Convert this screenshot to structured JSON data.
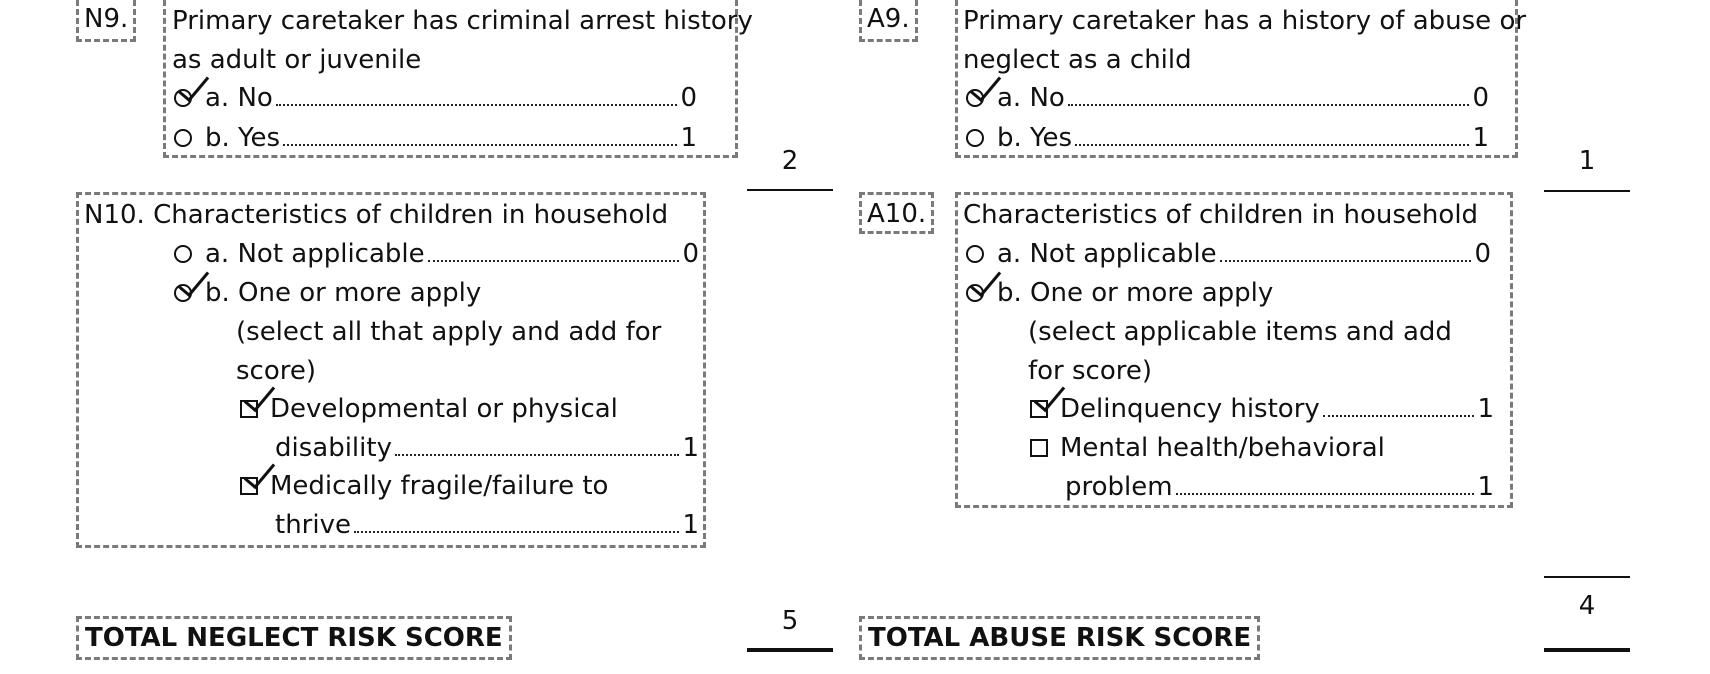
{
  "neglect": {
    "n9": {
      "tag": "N9.",
      "question_line1": "Primary caretaker has criminal arrest history",
      "question_line2": "as adult or juvenile",
      "option_a": "a. No",
      "option_a_value": "0",
      "option_b": "b. Yes",
      "option_b_value": "1",
      "score": "2"
    },
    "n10": {
      "tag": "N10.",
      "question": "Characteristics of children in household",
      "option_a": "a. Not applicable",
      "option_a_value": "0",
      "option_b": "b. One or more apply",
      "note_line1": "(select all that apply and add for",
      "note_line2": "score)",
      "item1_line1": "Developmental or physical",
      "item1_line2": "disability",
      "item1_value": "1",
      "item2_line1": "Medically  fragile/failure  to",
      "item2_line2": "thrive",
      "item2_value": "1"
    },
    "total_label": "TOTAL NEGLECT RISK SCORE",
    "total_score": "5"
  },
  "abuse": {
    "a9": {
      "tag": "A9.",
      "question_line1": "Primary caretaker has a history of abuse or",
      "question_line2": "neglect as a child",
      "option_a": "a. No",
      "option_a_value": "0",
      "option_b": "b. Yes",
      "option_b_value": "1",
      "score": "1"
    },
    "a10": {
      "tag": "A10.",
      "question": "Characteristics of children in household",
      "option_a": "a. Not applicable",
      "option_a_value": "0",
      "option_b": "b. One or more apply",
      "note_line1": "(select applicable items and add",
      "note_line2": "for score)",
      "item1": "Delinquency history",
      "item1_value": "1",
      "item2_line1": "Mental health/behavioral",
      "item2_line2": "problem",
      "item2_value": "1"
    },
    "total_label": "TOTAL ABUSE RISK SCORE",
    "total_score": "4"
  }
}
